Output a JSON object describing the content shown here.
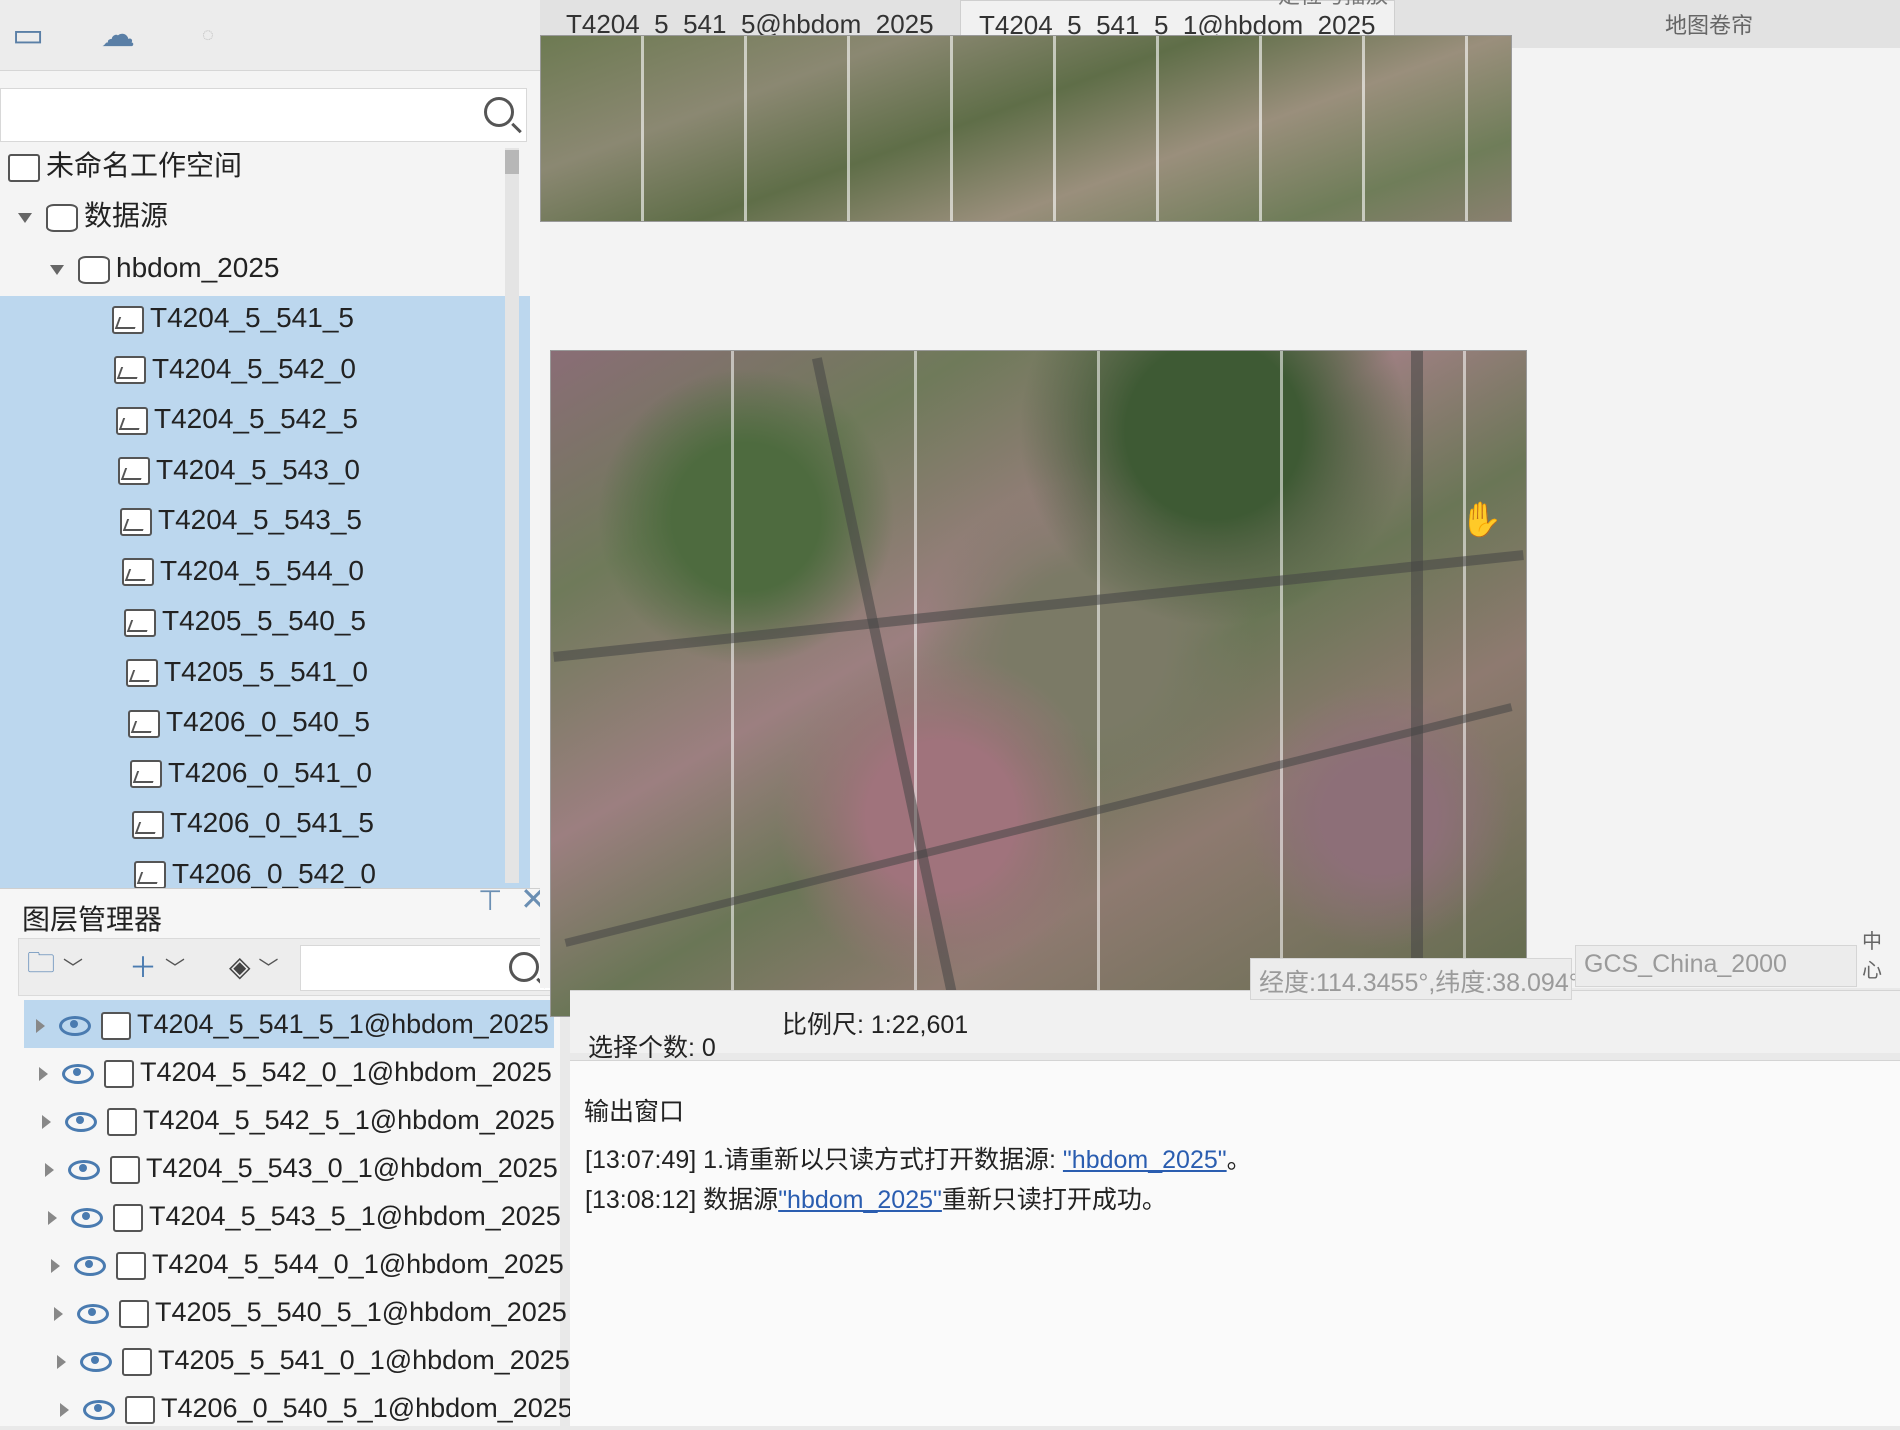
{
  "tabs": [
    {
      "label": "T4204_5_541_5@hbdom_2025"
    },
    {
      "label": "T4204_5_541_5_1@hbdom_2025"
    }
  ],
  "top_tab_partial": "定位与播放",
  "right_label": "地图卷帘",
  "search": {
    "placeholder": ""
  },
  "workspace": {
    "root": "未命名工作空间",
    "datasource_group": "数据源",
    "datasource": "hbdom_2025",
    "datasets": [
      "T4204_5_541_5",
      "T4204_5_542_0",
      "T4204_5_542_5",
      "T4204_5_543_0",
      "T4204_5_543_5",
      "T4204_5_544_0",
      "T4205_5_540_5",
      "T4205_5_541_0",
      "T4206_0_540_5",
      "T4206_0_541_0",
      "T4206_0_541_5",
      "T4206_0_542_0"
    ]
  },
  "layer_manager": {
    "title": "图层管理器",
    "layers": [
      "T4204_5_541_5_1@hbdom_2025",
      "T4204_5_542_0_1@hbdom_2025",
      "T4204_5_542_5_1@hbdom_2025",
      "T4204_5_543_0_1@hbdom_2025",
      "T4204_5_543_5_1@hbdom_2025",
      "T4204_5_544_0_1@hbdom_2025",
      "T4205_5_540_5_1@hbdom_2025",
      "T4205_5_541_0_1@hbdom_2025",
      "T4206_0_540_5_1@hbdom_2025"
    ]
  },
  "status": {
    "selection": "选择个数: 0",
    "scale": "比例尺:  1:22,601",
    "coords": "经度:114.3455°,纬度:38.094°",
    "crs": "GCS_China_2000",
    "right": "中心"
  },
  "output": {
    "title": "输出窗口",
    "lines": [
      {
        "time": "[13:07:49]",
        "text": "1.请重新以只读方式打开数据源: ",
        "link": "\"hbdom_2025\"",
        "suffix": "。"
      },
      {
        "time": "[13:08:12]",
        "text": "数据源",
        "link": "\"hbdom_2025\"",
        "suffix": "重新只读打开成功。"
      }
    ]
  },
  "icons": {
    "tree_root": "workspace-icon",
    "datasource": "database-icon",
    "dataset": "raster-icon",
    "visible": "eye-icon"
  }
}
